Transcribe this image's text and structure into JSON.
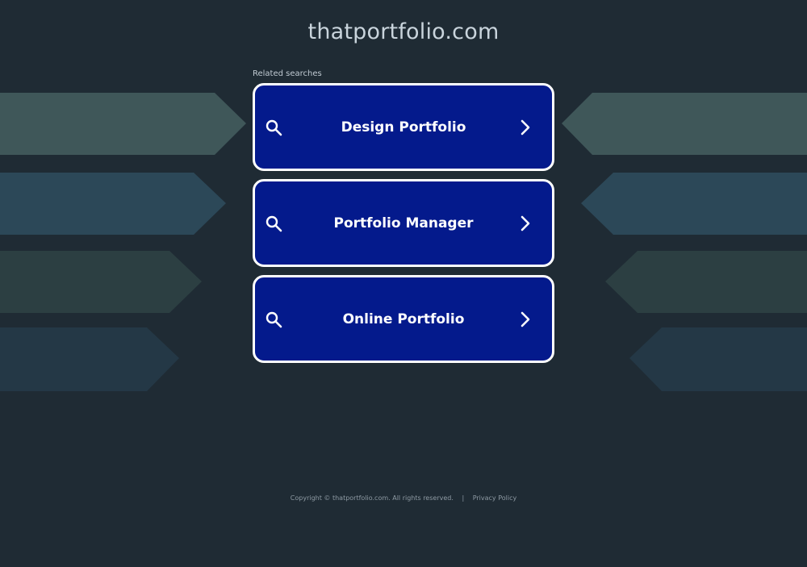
{
  "page": {
    "site_title": "thatportfolio.com",
    "related_label": "Related searches"
  },
  "searches": [
    {
      "label": "Design Portfolio"
    },
    {
      "label": "Portfolio Manager"
    },
    {
      "label": "Online Portfolio"
    }
  ],
  "footer": {
    "copyright": "Copyright © thatportfolio.com.  All rights reserved.",
    "separator": "|",
    "privacy_label": "Privacy Policy"
  },
  "colors": {
    "background": "#1f2b34",
    "button_fill": "#041a8c",
    "button_border": "#ffffff",
    "deco_band_1": "#3f5759",
    "deco_band_2": "#2c4858",
    "deco_band_3": "#2c3f42",
    "deco_band_4": "#243846"
  },
  "icons": {
    "search": "search-icon",
    "chevron": "chevron-right-icon"
  }
}
